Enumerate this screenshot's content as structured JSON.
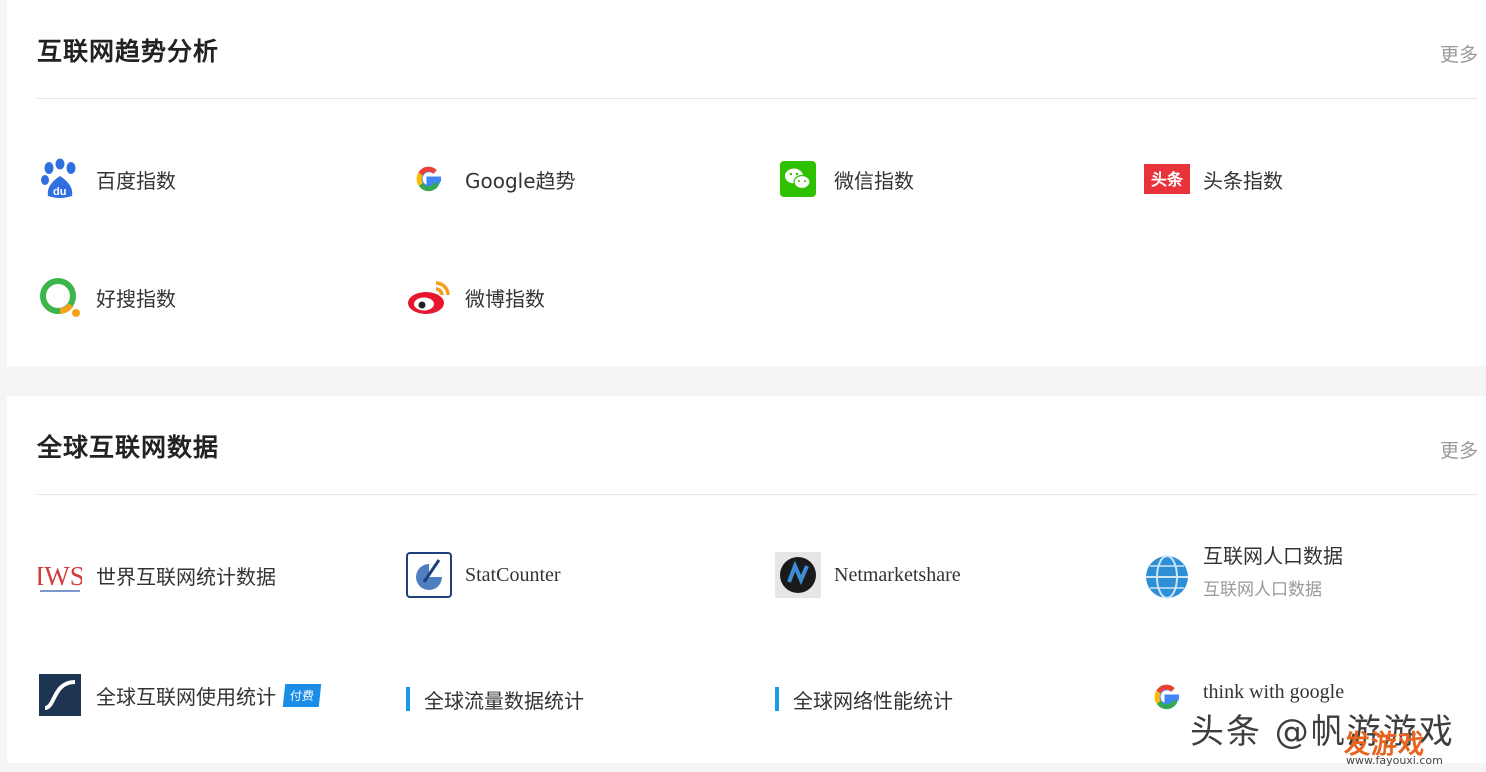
{
  "section1": {
    "title": "互联网趋势分析",
    "more": "更多",
    "items": [
      {
        "label": "百度指数",
        "icon": "baidu-icon"
      },
      {
        "label": "Google趋势",
        "icon": "google-icon"
      },
      {
        "label": "微信指数",
        "icon": "wechat-icon"
      },
      {
        "label": "头条指数",
        "icon": "toutiao-icon",
        "icon_text": "头条"
      },
      {
        "label": "好搜指数",
        "icon": "haosou-icon"
      },
      {
        "label": "微博指数",
        "icon": "weibo-icon"
      }
    ]
  },
  "section2": {
    "title": "全球互联网数据",
    "more": "更多",
    "items": [
      {
        "label": "世界互联网统计数据",
        "icon": "iws-icon",
        "icon_text": "IWS"
      },
      {
        "label": "StatCounter",
        "icon": "statcounter-icon"
      },
      {
        "label": "Netmarketshare",
        "icon": "netmarketshare-icon"
      },
      {
        "label": "互联网人口数据",
        "sublabel": "互联网人口数据",
        "icon": "globe-icon"
      },
      {
        "label": "全球互联网使用统计",
        "badge": "付费",
        "icon": "usage-stats-icon"
      },
      {
        "label": "全球流量数据统计",
        "icon": "bar-marker"
      },
      {
        "label": "全球网络性能统计",
        "icon": "bar-marker"
      },
      {
        "label": "think with google",
        "icon": "google-icon"
      }
    ]
  },
  "watermark": {
    "text": "头条 @帆游游戏",
    "brand": "发游戏",
    "url": "www.fayouxi.com"
  }
}
